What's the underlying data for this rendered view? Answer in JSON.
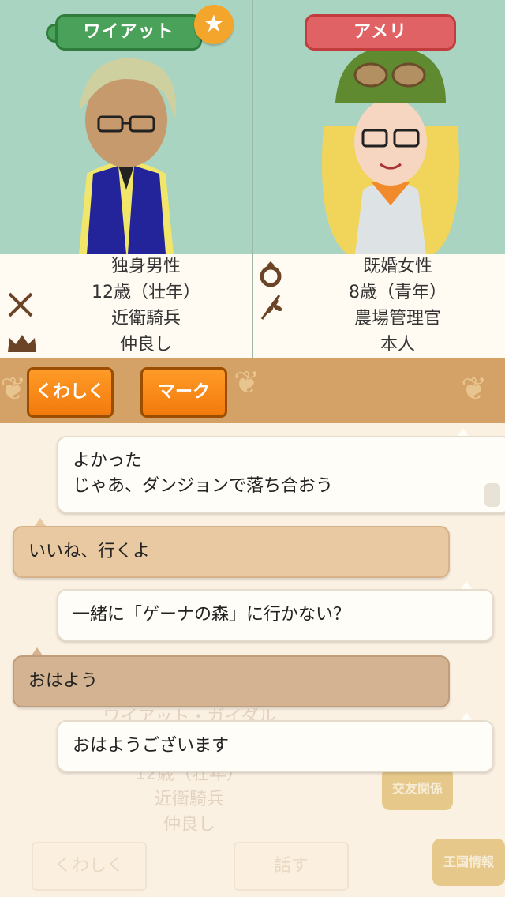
{
  "left_character": {
    "name": "ワイアット",
    "favorite_icon": "star-icon",
    "info": [
      "独身男性",
      "12歳（壮年）",
      "近衛騎兵",
      "仲良し"
    ]
  },
  "right_character": {
    "name": "アメリ",
    "info": [
      "既婚女性",
      "8歳（青年）",
      "農場管理官",
      "本人"
    ]
  },
  "buttons": {
    "detail": "くわしく",
    "mark": "マーク"
  },
  "chat": [
    {
      "side": "right",
      "lines": [
        "よかった",
        "じゃあ、ダンジョンで落ち合おう"
      ]
    },
    {
      "side": "left",
      "lines": [
        "いいね、行くよ"
      ]
    },
    {
      "side": "right",
      "lines": [
        "一緒に「ゲーナの森」に行かない？"
      ]
    },
    {
      "side": "left",
      "lines": [
        "おはよう"
      ]
    },
    {
      "side": "right",
      "lines": [
        "おはようございます"
      ]
    }
  ],
  "background": {
    "ghost_name": "ワイアット・ガイダル",
    "ghost_age": "12歳（壮年）",
    "ghost_job": "近衛騎兵",
    "ghost_relation": "仲良し",
    "ghost_detail": "くわしく",
    "ghost_talk": "話す",
    "menu_friends": "交友関係",
    "menu_kingdom": "王国情報"
  }
}
